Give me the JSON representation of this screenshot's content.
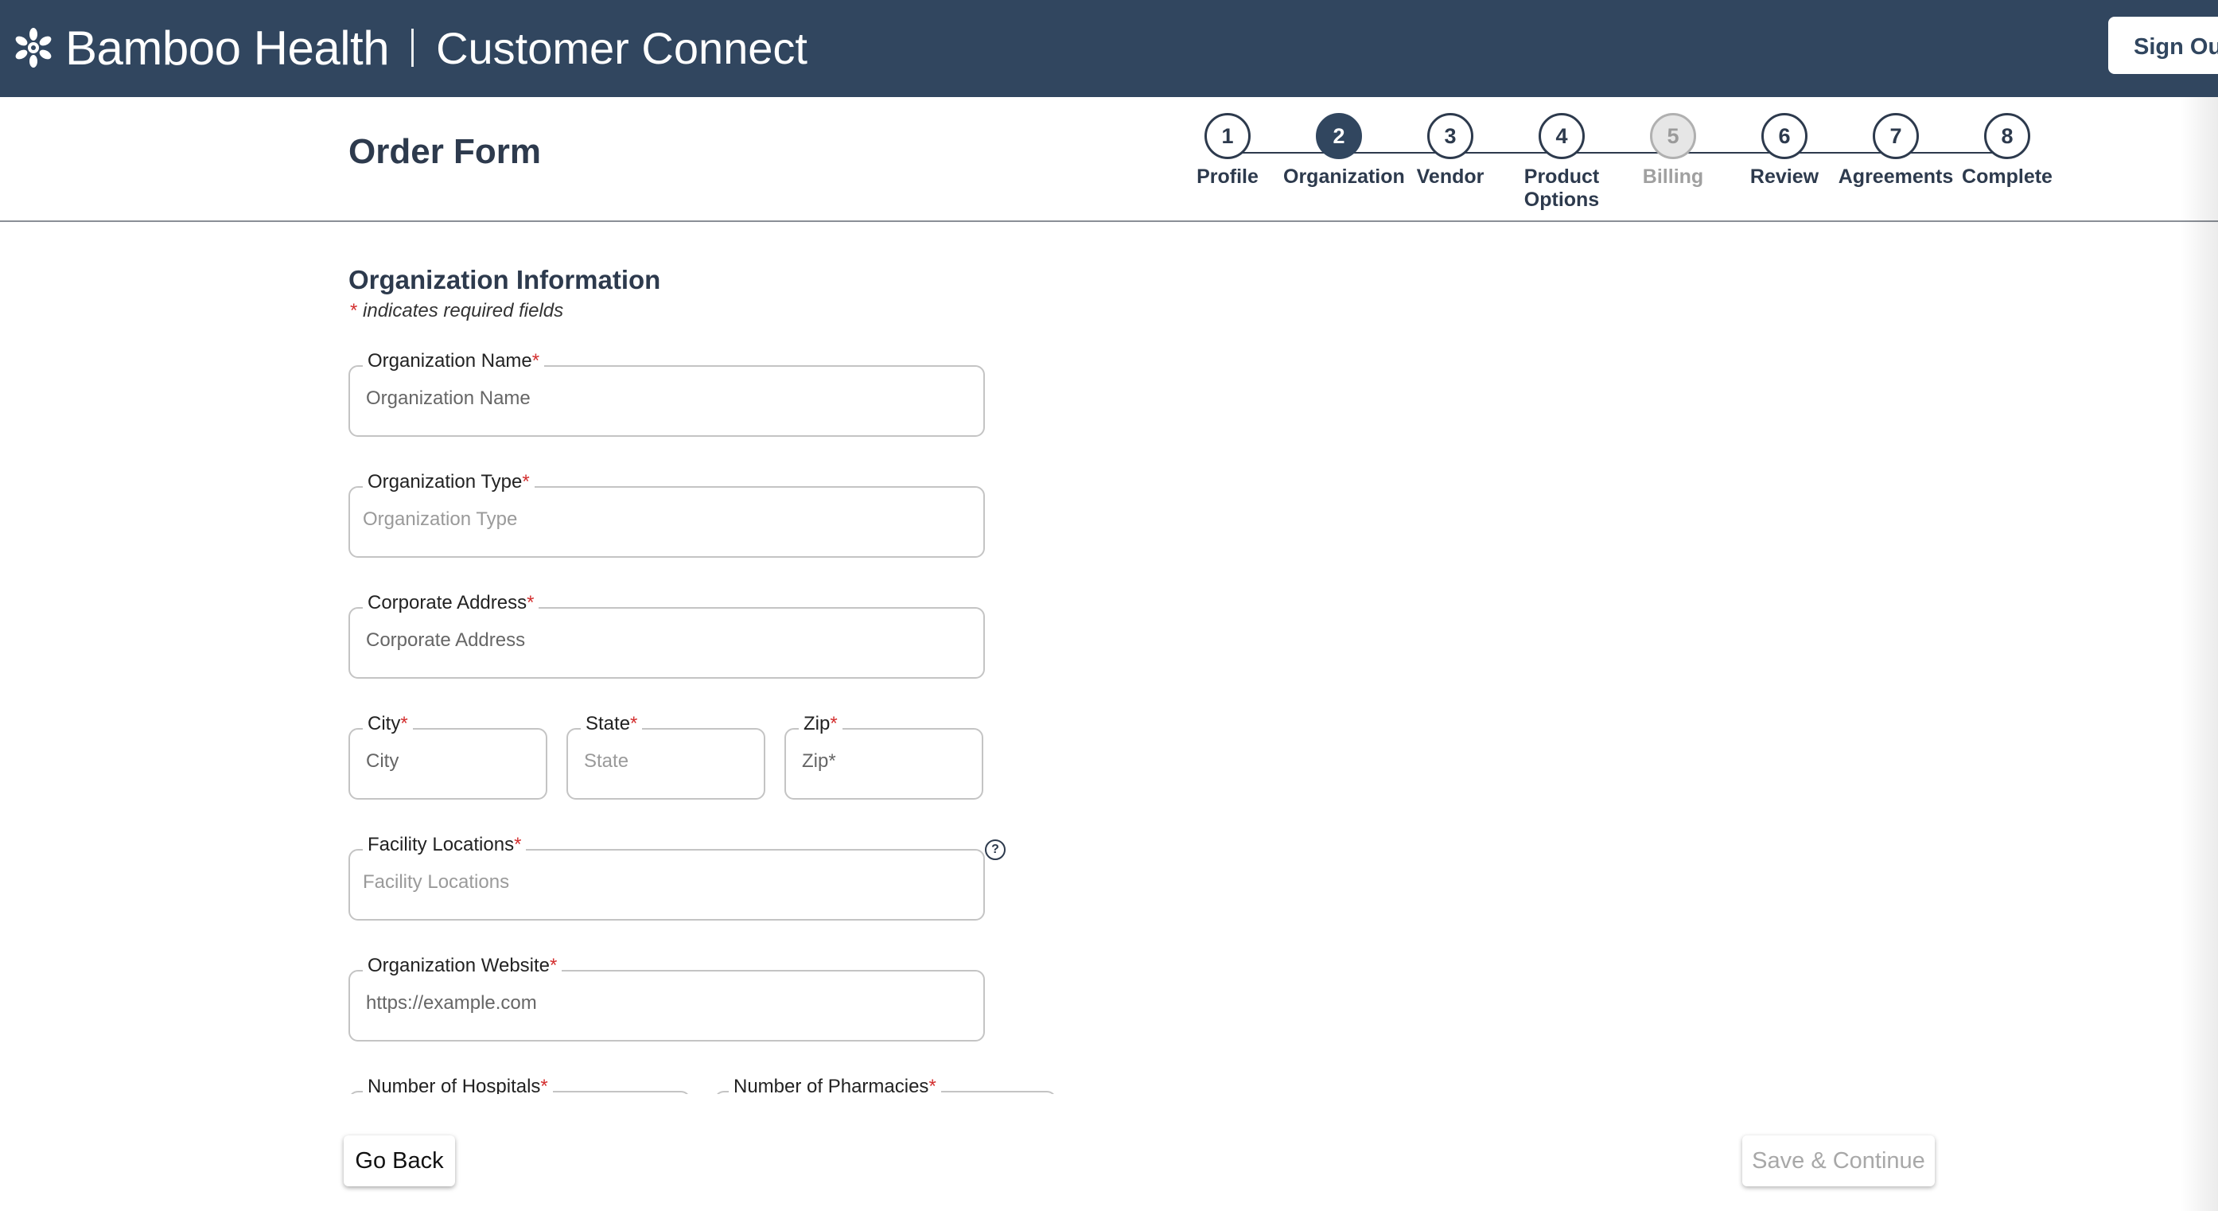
{
  "header": {
    "brand": "Bamboo Health",
    "app_name": "Customer Connect",
    "sign_out": "Sign Out",
    "bg_color": "#31465f"
  },
  "page": {
    "title": "Order Form"
  },
  "stepper": {
    "steps": [
      {
        "number": "1",
        "label": "Profile",
        "state": "done"
      },
      {
        "number": "2",
        "label": "Organization",
        "state": "active"
      },
      {
        "number": "3",
        "label": "Vendor",
        "state": "pending"
      },
      {
        "number": "4",
        "label": "Product Options",
        "state": "pending"
      },
      {
        "number": "5",
        "label": "Billing",
        "state": "disabled"
      },
      {
        "number": "6",
        "label": "Review",
        "state": "pending"
      },
      {
        "number": "7",
        "label": "Agreements",
        "state": "pending"
      },
      {
        "number": "8",
        "label": "Complete",
        "state": "pending"
      }
    ]
  },
  "form": {
    "section_title": "Organization Information",
    "required_note_star": "*",
    "required_note": " indicates required fields",
    "fields": {
      "org_name": {
        "label": "Organization Name",
        "placeholder": "Organization Name"
      },
      "org_type": {
        "label": "Organization Type",
        "placeholder": "Organization Type"
      },
      "address": {
        "label": "Corporate Address",
        "placeholder": "Corporate Address"
      },
      "city": {
        "label": "City",
        "placeholder": "City"
      },
      "state": {
        "label": "State",
        "placeholder": "State"
      },
      "zip": {
        "label": "Zip",
        "placeholder": "Zip*"
      },
      "facilities": {
        "label": "Facility Locations",
        "placeholder": "Facility Locations"
      },
      "website": {
        "label": "Organization Website",
        "placeholder": "https://example.com"
      },
      "hospitals": {
        "label": "Number of Hospitals"
      },
      "pharmacies": {
        "label": "Number of Pharmacies"
      }
    },
    "required_star": "*",
    "help_icon": "question-circle-icon",
    "help_glyph": "?"
  },
  "footer": {
    "back_label": "Go Back",
    "save_label": "Save & Continue"
  }
}
